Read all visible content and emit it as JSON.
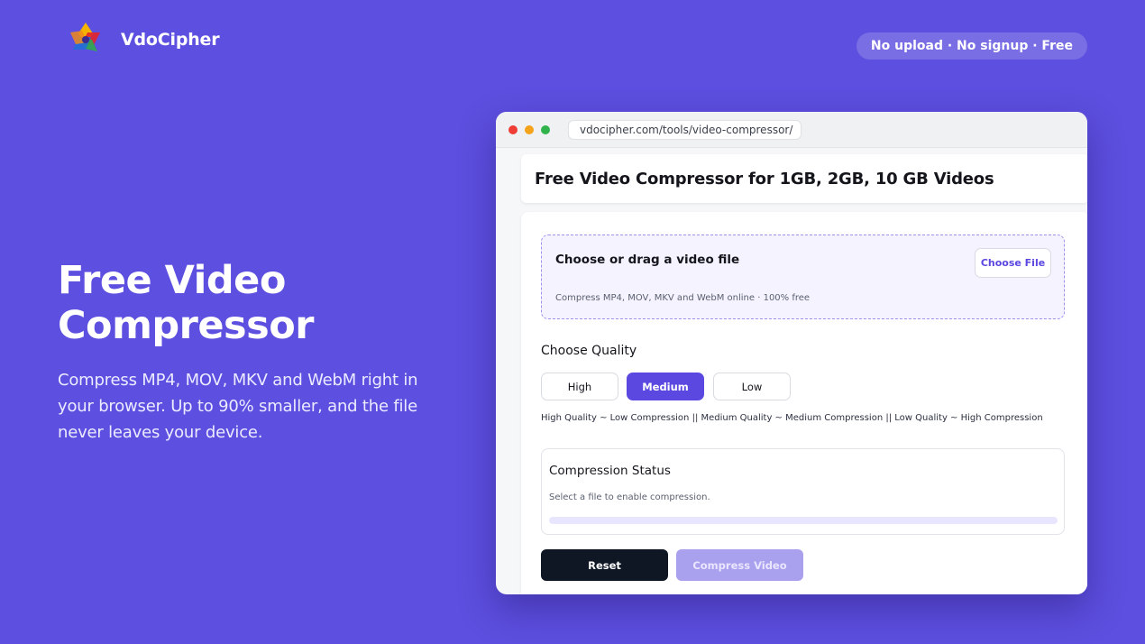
{
  "header": {
    "brand": "VdoCipher",
    "logo_icon": "vdocipher-logo-icon",
    "badge": "No upload · No signup · Free"
  },
  "hero": {
    "title": "Free Video Compressor",
    "subtitle": "Compress MP4, MOV, MKV and WebM right in your browser. Up to 90% smaller, and the file never leaves your device."
  },
  "browser": {
    "url": "vdocipher.com/tools/video-compressor/"
  },
  "page": {
    "title": "Free Video Compressor for 1GB, 2GB, 10 GB Videos",
    "dropzone": {
      "title": "Choose or drag a video file",
      "subtitle": "Compress MP4, MOV, MKV and WebM online · 100% free",
      "button": "Choose File"
    },
    "quality": {
      "label": "Choose Quality",
      "options": [
        "High",
        "Medium",
        "Low"
      ],
      "selected": "Medium",
      "note": "High Quality ~ Low Compression || Medium Quality ~ Medium Compression || Low Quality ~ High Compression"
    },
    "status": {
      "title": "Compression Status",
      "text": "Select a file to enable compression.",
      "progress": 0
    },
    "actions": {
      "reset": "Reset",
      "compress": "Compress Video"
    }
  },
  "colors": {
    "background": "#5d4fdf",
    "accent": "#5b48e0",
    "dark_button": "#0f1624",
    "disabled_button": "#a9a0ee"
  }
}
